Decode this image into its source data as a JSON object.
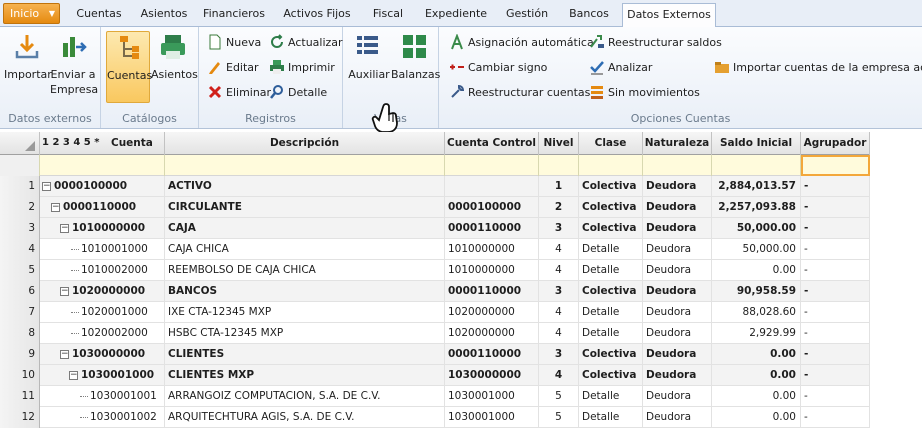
{
  "tabs": {
    "inicio": "Inicio",
    "items": [
      "Cuentas",
      "Asientos",
      "Financieros",
      "Activos Fijos",
      "Fiscal",
      "Expediente",
      "Gestión",
      "Bancos",
      "Datos Externos"
    ]
  },
  "ribbon": {
    "datos_externos": {
      "label": "Datos externos",
      "importar": "Importar",
      "enviar": "Enviar a",
      "empresa": "Empresa"
    },
    "catalogos": {
      "label": "Catálogos",
      "cuentas": "Cuentas",
      "asientos": "Asientos"
    },
    "registros": {
      "label": "Registros",
      "nueva": "Nueva",
      "actualizar": "Actualizar",
      "editar": "Editar",
      "imprimir": "Imprimir",
      "eliminar": "Eliminar",
      "detalle": "Detalle"
    },
    "vistas": {
      "label": "Vistas",
      "auxiliar": "Auxiliar",
      "balanzas": "Balanzas"
    },
    "opciones": {
      "label": "Opciones Cuentas",
      "asignacion": "Asignación automática",
      "cambiar_signo": "Cambiar signo",
      "reestructurar_cuentas": "Reestructurar cuentas",
      "reestructurar_saldos": "Reestructurar saldos",
      "analizar": "Analizar",
      "sin_movimientos": "Sin movimientos",
      "importar_cuentas": "Importar cuentas de la empresa actual"
    }
  },
  "grid": {
    "levels": "1 2 3 4 5 *",
    "headers": {
      "cuenta": "Cuenta",
      "descripcion": "Descripción",
      "control": "Cuenta Control",
      "nivel": "Nivel",
      "clase": "Clase",
      "naturaleza": "Naturaleza",
      "saldo": "Saldo Inicial",
      "agrupador": "Agrupador"
    },
    "rows": [
      {
        "n": "1",
        "cuenta": "0000100000",
        "desc": "ACTIVO",
        "control": "",
        "nivel": "1",
        "clase": "Colectiva",
        "nat": "Deudora",
        "saldo": "2,884,013.57",
        "agr": "-",
        "grp": true,
        "depth": 0
      },
      {
        "n": "2",
        "cuenta": "0000110000",
        "desc": "CIRCULANTE",
        "control": "0000100000",
        "nivel": "2",
        "clase": "Colectiva",
        "nat": "Deudora",
        "saldo": "2,257,093.88",
        "agr": "-",
        "grp": true,
        "depth": 1
      },
      {
        "n": "3",
        "cuenta": "1010000000",
        "desc": "CAJA",
        "control": "0000110000",
        "nivel": "3",
        "clase": "Colectiva",
        "nat": "Deudora",
        "saldo": "50,000.00",
        "agr": "-",
        "grp": true,
        "depth": 2
      },
      {
        "n": "4",
        "cuenta": "1010001000",
        "desc": "CAJA CHICA",
        "control": "1010000000",
        "nivel": "4",
        "clase": "Detalle",
        "nat": "Deudora",
        "saldo": "50,000.00",
        "agr": "-",
        "grp": false,
        "depth": 3
      },
      {
        "n": "5",
        "cuenta": "1010002000",
        "desc": "REEMBOLSO DE CAJA CHICA",
        "control": "1010000000",
        "nivel": "4",
        "clase": "Detalle",
        "nat": "Deudora",
        "saldo": "0.00",
        "agr": "-",
        "grp": false,
        "depth": 3
      },
      {
        "n": "6",
        "cuenta": "1020000000",
        "desc": "BANCOS",
        "control": "0000110000",
        "nivel": "3",
        "clase": "Colectiva",
        "nat": "Deudora",
        "saldo": "90,958.59",
        "agr": "-",
        "grp": true,
        "depth": 2
      },
      {
        "n": "7",
        "cuenta": "1020001000",
        "desc": "IXE CTA-12345 MXP",
        "control": "1020000000",
        "nivel": "4",
        "clase": "Detalle",
        "nat": "Deudora",
        "saldo": "88,028.60",
        "agr": "-",
        "grp": false,
        "depth": 3
      },
      {
        "n": "8",
        "cuenta": "1020002000",
        "desc": "HSBC CTA-12345 MXP",
        "control": "1020000000",
        "nivel": "4",
        "clase": "Detalle",
        "nat": "Deudora",
        "saldo": "2,929.99",
        "agr": "-",
        "grp": false,
        "depth": 3
      },
      {
        "n": "9",
        "cuenta": "1030000000",
        "desc": "CLIENTES",
        "control": "0000110000",
        "nivel": "3",
        "clase": "Colectiva",
        "nat": "Deudora",
        "saldo": "0.00",
        "agr": "-",
        "grp": true,
        "depth": 2
      },
      {
        "n": "10",
        "cuenta": "1030001000",
        "desc": "CLIENTES MXP",
        "control": "1030000000",
        "nivel": "4",
        "clase": "Colectiva",
        "nat": "Deudora",
        "saldo": "0.00",
        "agr": "-",
        "grp": true,
        "depth": 3
      },
      {
        "n": "11",
        "cuenta": "1030001001",
        "desc": "ARRANGOIZ COMPUTACION, S.A. DE C.V.",
        "control": "1030001000",
        "nivel": "5",
        "clase": "Detalle",
        "nat": "Deudora",
        "saldo": "0.00",
        "agr": "-",
        "grp": false,
        "depth": 4
      },
      {
        "n": "12",
        "cuenta": "1030001002",
        "desc": "ARQUITECHTURA AGIS, S.A. DE C.V.",
        "control": "1030001000",
        "nivel": "5",
        "clase": "Detalle",
        "nat": "Deudora",
        "saldo": "0.00",
        "agr": "-",
        "grp": false,
        "depth": 4
      }
    ]
  },
  "colors": {
    "accent": "#f0a030",
    "header_bg": "#e3e3e3",
    "filter_bg": "#fffbdc",
    "group_row": "#f3f3f3"
  }
}
